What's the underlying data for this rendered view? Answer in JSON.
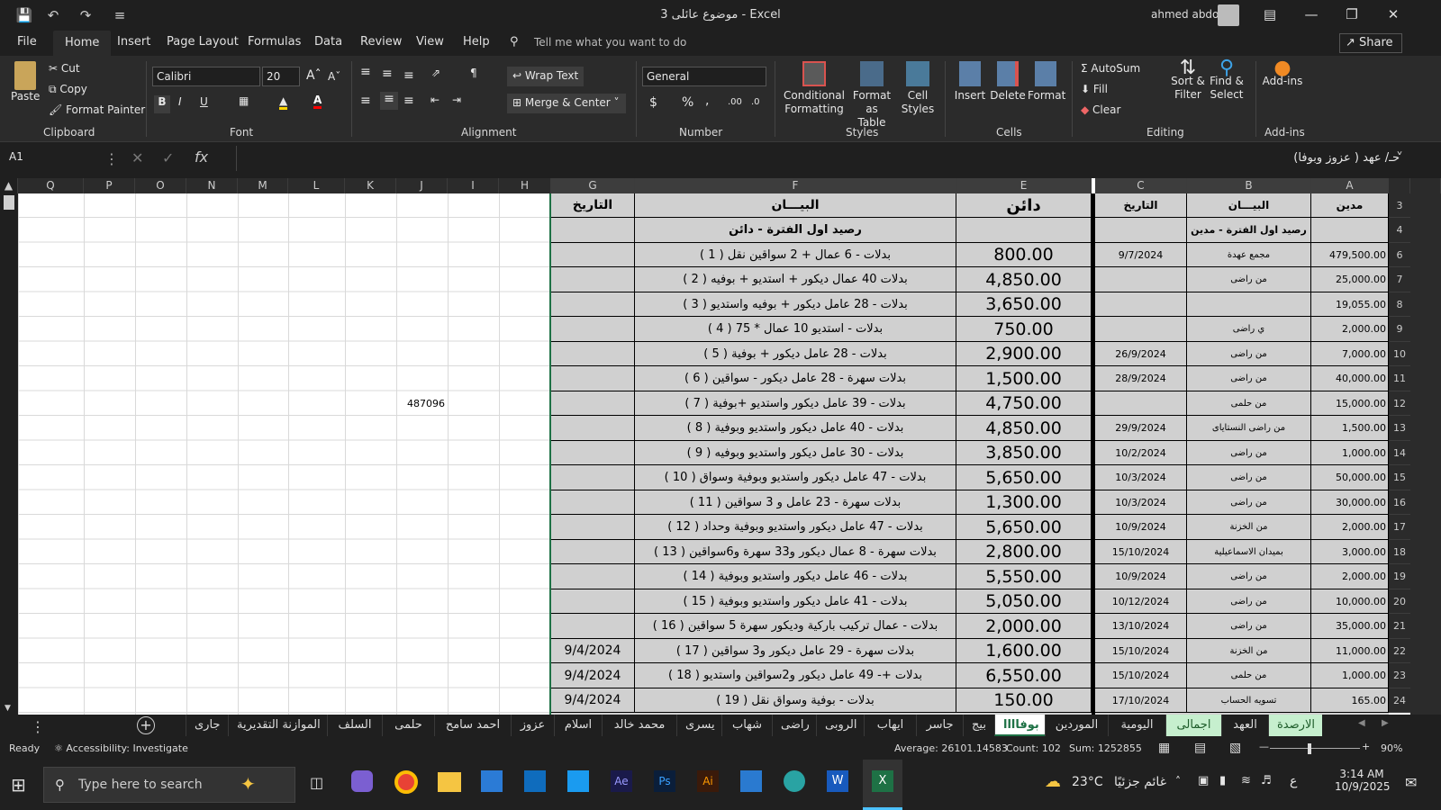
{
  "titlebar": {
    "doc_title": "موضوع عائلى 3  -  Excel",
    "user": "ahmed abdo",
    "undo": "↶",
    "redo": "↷"
  },
  "tabs": [
    "File",
    "Home",
    "Insert",
    "Page Layout",
    "Formulas",
    "Data",
    "Review",
    "View",
    "Help"
  ],
  "tell_me": "Tell me what you want to do",
  "share": "Share",
  "ribbon": {
    "clipboard": {
      "paste": "Paste",
      "cut": "Cut",
      "copy": "Copy",
      "format_painter": "Format Painter",
      "label": "Clipboard"
    },
    "font": {
      "name": "Calibri",
      "size": "20",
      "bold": "B",
      "italic": "I",
      "underline": "U",
      "label": "Font"
    },
    "alignment": {
      "wrap": "Wrap Text",
      "merge": "Merge & Center",
      "label": "Alignment"
    },
    "number": {
      "format": "General",
      "currency": "$",
      "percent": "%",
      "comma": ",",
      "label": "Number"
    },
    "styles": {
      "conditional": "Conditional",
      "conditional2": "Formatting",
      "format_table": "Format as",
      "format_table2": "Table",
      "cell_styles": "Cell",
      "cell_styles2": "Styles",
      "label": "Styles"
    },
    "cells": {
      "insert": "Insert",
      "delete": "Delete",
      "format": "Format",
      "label": "Cells"
    },
    "editing": {
      "autosum": "AutoSum",
      "fill": "Fill",
      "clear": "Clear",
      "sort": "Sort &",
      "sort2": "Filter",
      "find": "Find &",
      "find2": "Select",
      "label": "Editing"
    },
    "addins": {
      "label1": "Add-ins",
      "label": "Add-ins"
    }
  },
  "formula_bar": {
    "name_box": "A1",
    "content": "حـ/ عهد ( عزوز وبوفا)"
  },
  "columns": [
    "A",
    "B",
    "C",
    "D",
    "E",
    "F",
    "G",
    "H",
    "I",
    "J",
    "K",
    "L",
    "M",
    "N",
    "O",
    "P",
    "Q"
  ],
  "headers": {
    "debit": "مدين",
    "desc_left": "البيـــان",
    "date_left": "التاريخ",
    "credit": "دائن",
    "desc_right": "البيـــان",
    "date_right": "التاريخ",
    "open_debit": "رصيد اول الفترة - مدين",
    "open_credit": "رصيد اول الفترة - دائن"
  },
  "row_numbers": [
    "3",
    "4",
    "6",
    "7",
    "8",
    "9",
    "10",
    "11",
    "12",
    "13",
    "14",
    "15",
    "16",
    "17",
    "18",
    "19",
    "20",
    "21",
    "22",
    "23",
    "24"
  ],
  "rows": [
    {
      "a": "479,500.00",
      "b": "مجمع عهدة",
      "c": "9/7/2024",
      "e": "800.00",
      "f": "بدلات - 6 عمال + 2 سواقين نقل  ( 1 )",
      "g": ""
    },
    {
      "a": "25,000.00",
      "b": "من راضى",
      "c": "",
      "e": "4,850.00",
      "f": "بدلات 40 عمال ديكور + استديو + بوفيه  ( 2 )",
      "g": ""
    },
    {
      "a": "19,055.00",
      "b": "",
      "c": "",
      "e": "3,650.00",
      "f": "بدلات - 28 عامل ديكور + بوفيه واستديو  ( 3 )",
      "g": ""
    },
    {
      "a": "2,000.00",
      "b": "ي راضى",
      "c": "",
      "e": "750.00",
      "f": "بدلات - استديو 10 عمال * 75  ( 4 )",
      "g": ""
    },
    {
      "a": "7,000.00",
      "b": "من راضى",
      "c": "26/9/2024",
      "e": "2,900.00",
      "f": "بدلات - 28 عامل ديكور + بوفية  ( 5 )",
      "g": ""
    },
    {
      "a": "40,000.00",
      "b": "من راضى",
      "c": "28/9/2024",
      "e": "1,500.00",
      "f": "بدلات سهرة - 28 عامل ديكور - سواقين  ( 6 )",
      "g": ""
    },
    {
      "a": "15,000.00",
      "b": "من حلمى",
      "c": "",
      "e": "4,750.00",
      "f": "بدلات - 39 عامل ديكور واستديو +بوفية  ( 7 )",
      "g": ""
    },
    {
      "a": "1,500.00",
      "b": "من راضى النستاياى",
      "c": "29/9/2024",
      "e": "4,850.00",
      "f": "بدلات - 40 عامل ديكور واستديو وبوفية  ( 8 )",
      "g": ""
    },
    {
      "a": "1,000.00",
      "b": "من راضى",
      "c": "10/2/2024",
      "e": "3,850.00",
      "f": "بدلات - 30 عامل ديكور واستديو وبوفيه  ( 9 )",
      "g": ""
    },
    {
      "a": "50,000.00",
      "b": "من راضى",
      "c": "10/3/2024",
      "e": "5,650.00",
      "f": "بدلات - 47 عامل ديكور واستديو وبوفية وسواق  ( 10 )",
      "g": ""
    },
    {
      "a": "30,000.00",
      "b": "من راضى",
      "c": "10/3/2024",
      "e": "1,300.00",
      "f": "بدلات سهرة - 23 عامل و 3 سواقين  ( 11 )",
      "g": ""
    },
    {
      "a": "2,000.00",
      "b": "من الخزنة",
      "c": "10/9/2024",
      "e": "5,650.00",
      "f": "بدلات - 47 عامل ديكور واستديو وبوفية وحداد  ( 12 )",
      "g": ""
    },
    {
      "a": "3,000.00",
      "b": "بميدان الاسماعيلية",
      "c": "15/10/2024",
      "e": "2,800.00",
      "f": "بدلات سهرة - 8 عمال ديكور و33 سهرة و6سواقين  ( 13 )",
      "g": ""
    },
    {
      "a": "2,000.00",
      "b": "من راضى",
      "c": "10/9/2024",
      "e": "5,550.00",
      "f": "بدلات - 46 عامل ديكور واستديو وبوفية   ( 14 )",
      "g": ""
    },
    {
      "a": "10,000.00",
      "b": "من راضى",
      "c": "10/12/2024",
      "e": "5,050.00",
      "f": "بدلات - 41 عامل ديكور واستديو وبوفية  ( 15 )",
      "g": ""
    },
    {
      "a": "35,000.00",
      "b": "من راضى",
      "c": "13/10/2024",
      "e": "2,000.00",
      "f": "بدلات - عمال تركيب باركية وديكور سهرة 5 سواقين  ( 16 )",
      "g": ""
    },
    {
      "a": "11,000.00",
      "b": "من الخزنة",
      "c": "15/10/2024",
      "e": "1,600.00",
      "f": "بدلات سهرة - 29 عامل ديكور و3 سواقين  ( 17 )",
      "g": "9/4/2024"
    },
    {
      "a": "1,000.00",
      "b": "من حلمى",
      "c": "15/10/2024",
      "e": "6,550.00",
      "f": "بدلات +- 49 عامل ديكور  و2سواقين واستديو  ( 18 )",
      "g": "9/4/2024"
    },
    {
      "a": "165.00",
      "b": "تسويه الحساب",
      "c": "17/10/2024",
      "e": "150.00",
      "f": "بدلات - بوفية وسواق نقل  ( 19 )",
      "g": "9/4/2024"
    }
  ],
  "j12_value": "487096",
  "sheet_tabs": [
    "جارى",
    "الموازنة التقديرية",
    "السلف",
    "حلمى",
    "احمد سامح",
    "عزوز",
    "اسلام",
    "محمد خالد",
    "يسرى",
    "شهاب",
    "راضى",
    "الروبى",
    "ايهاب",
    "جاسر",
    "بيج",
    "بوفاااا",
    "الموردين",
    "اليومية",
    "اجمالى",
    "العهد",
    "الارصدة"
  ],
  "status": {
    "ready": "Ready",
    "accessibility": "Accessibility: Investigate",
    "average": "Average: 26101.14583",
    "count": "Count: 102",
    "sum": "Sum: 1252855",
    "zoom": "90%"
  },
  "taskbar": {
    "search": "Type here to search",
    "weather": "23°C",
    "weather_text": "غائم جزئيًا",
    "lang": "ع",
    "time": "3:14 AM",
    "date": "10/9/2025"
  },
  "colors": {
    "accent": "#1e7145",
    "sheet_green": "#c6efce",
    "table_gray": "#d0d0d0"
  }
}
